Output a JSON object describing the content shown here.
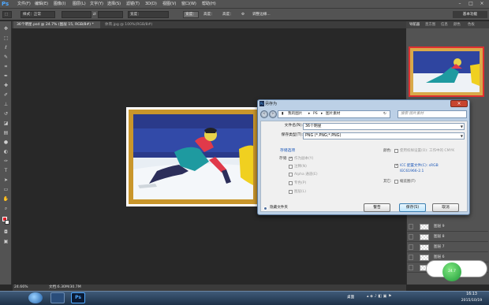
{
  "app": {
    "logo": "Ps",
    "menu": [
      "文件(F)",
      "编辑(E)",
      "图像(I)",
      "图层(L)",
      "文字(Y)",
      "选择(S)",
      "滤镜(T)",
      "3D(D)",
      "视图(V)",
      "窗口(W)",
      "帮助(H)"
    ],
    "window_buttons": [
      "–",
      "□",
      "×"
    ]
  },
  "options_bar": {
    "style_label": "样式：",
    "style_value": "正常",
    "width_label": "宽度：",
    "height_label": "高度：",
    "refine_label": "调整边缘...",
    "workspace": "基本功能"
  },
  "tabs": [
    "36个明星.psd @ 24.7% (图层 15, RGB/8#) *",
    "体育.jpg @ 100%(RGB/8#)"
  ],
  "panels": {
    "tabs": [
      "导航器",
      "直方图",
      "信息",
      "颜色",
      "色板"
    ],
    "layers": [
      "图层 9",
      "图层 8",
      "图层 7",
      "图层 6",
      "图层 5"
    ],
    "icons": [
      "eye-icon",
      "layer-thumb"
    ]
  },
  "status": {
    "zoom": "24.66%",
    "doc": "文档:6.30M/30.7M"
  },
  "dialog": {
    "title": "另存为",
    "breadcrumb": [
      "我的图片",
      "PS",
      "图片素材"
    ],
    "search_placeholder": "搜索 图片素材",
    "filename_label": "文件名(N):",
    "filename_value": "36个明星",
    "filetype_label": "保存类型(T):",
    "filetype_value": "PNG (*.PNG;*.PNG)",
    "save_options_title": "存储选项",
    "save_label": "存储:",
    "opts": [
      "作为副本(Y)",
      "注释(N)",
      "Alpha 通道(E)",
      "专色(P)",
      "图层(L)"
    ],
    "color_label": "颜色:",
    "color_opts": [
      "使用校样设置(O): 工作中的 CMYK",
      "ICC 配置文件(C): sRGB IEC61966-2.1"
    ],
    "other_label": "其它:",
    "thumbnail": "缩览图(T)",
    "hide_folders": "隐藏文件夹",
    "btn_warning": "警告",
    "btn_save": "保存(S)",
    "btn_cancel": "取消"
  },
  "taskbar": {
    "time": "16:13",
    "date": "2015/10/19",
    "tray_label": "桌面"
  },
  "widget": {
    "label": "24.7"
  },
  "colors": {
    "ps_blue": "#4ea8ff",
    "fg_swatch": "#e0202a",
    "bg_swatch": "#ffffff"
  }
}
